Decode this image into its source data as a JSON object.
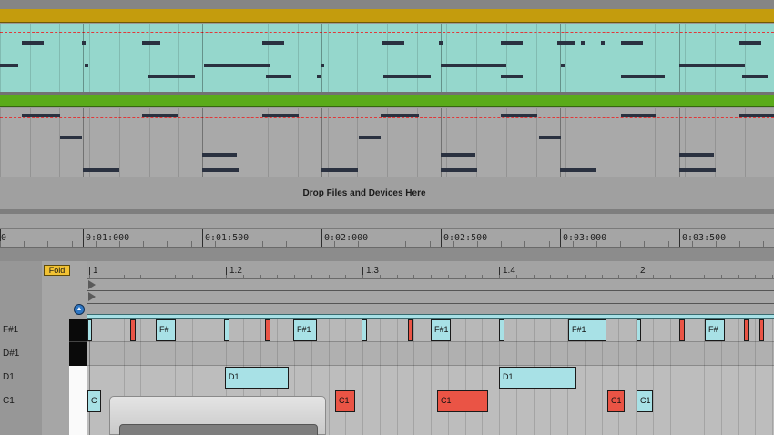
{
  "colors": {
    "track1_header": "#c49c0d",
    "track1_clip": "#95d7cc",
    "track2_header": "#5aab1a",
    "track2_clip": "#a9a9a9",
    "dashed_line": "#e0393a",
    "note_dark": "#2a3140",
    "midi_note_blue": "#a8e1e6",
    "midi_note_red": "#ea5445",
    "fold_button": "#f2c233"
  },
  "arrangement": {
    "drop_zone_text": "Drop Files and Devices Here"
  },
  "time_ruler": {
    "labels": [
      "0",
      "0:01:000",
      "0:01:500",
      "0:02:000",
      "0:02:500",
      "0:03:000",
      "0:03:500"
    ]
  },
  "clip_editor": {
    "fold_label": "Fold",
    "bar_labels": [
      "1",
      "1.2",
      "1.3",
      "1.4",
      "2"
    ],
    "keys": [
      {
        "label": "F#1",
        "color": "black"
      },
      {
        "label": "D#1",
        "color": "black"
      },
      {
        "label": "D1",
        "color": "white"
      },
      {
        "label": "C1",
        "color": "white"
      }
    ],
    "notes": {
      "fs1": [
        {
          "label": "",
          "color": "blue"
        },
        {
          "label": "",
          "color": "red"
        },
        {
          "label": "F#",
          "color": "blue"
        },
        {
          "label": "",
          "color": "blue"
        },
        {
          "label": "",
          "color": "red"
        },
        {
          "label": "F#1",
          "color": "blue"
        },
        {
          "label": "",
          "color": "blue"
        },
        {
          "label": "",
          "color": "red"
        },
        {
          "label": "F#1",
          "color": "blue"
        },
        {
          "label": "",
          "color": "blue"
        },
        {
          "label": "F#1",
          "color": "blue"
        },
        {
          "label": "",
          "color": "blue"
        },
        {
          "label": "",
          "color": "red"
        },
        {
          "label": "F#",
          "color": "blue"
        },
        {
          "label": "",
          "color": "red"
        },
        {
          "label": "",
          "color": "red"
        }
      ],
      "d1": [
        {
          "label": "D1",
          "color": "blue"
        },
        {
          "label": "D1",
          "color": "blue"
        }
      ],
      "c1": [
        {
          "label": "C",
          "color": "blue"
        },
        {
          "label": "C1",
          "color": "red"
        },
        {
          "label": "C1",
          "color": "red"
        },
        {
          "label": "C1",
          "color": "red"
        },
        {
          "label": "C1",
          "color": "blue"
        }
      ]
    }
  }
}
